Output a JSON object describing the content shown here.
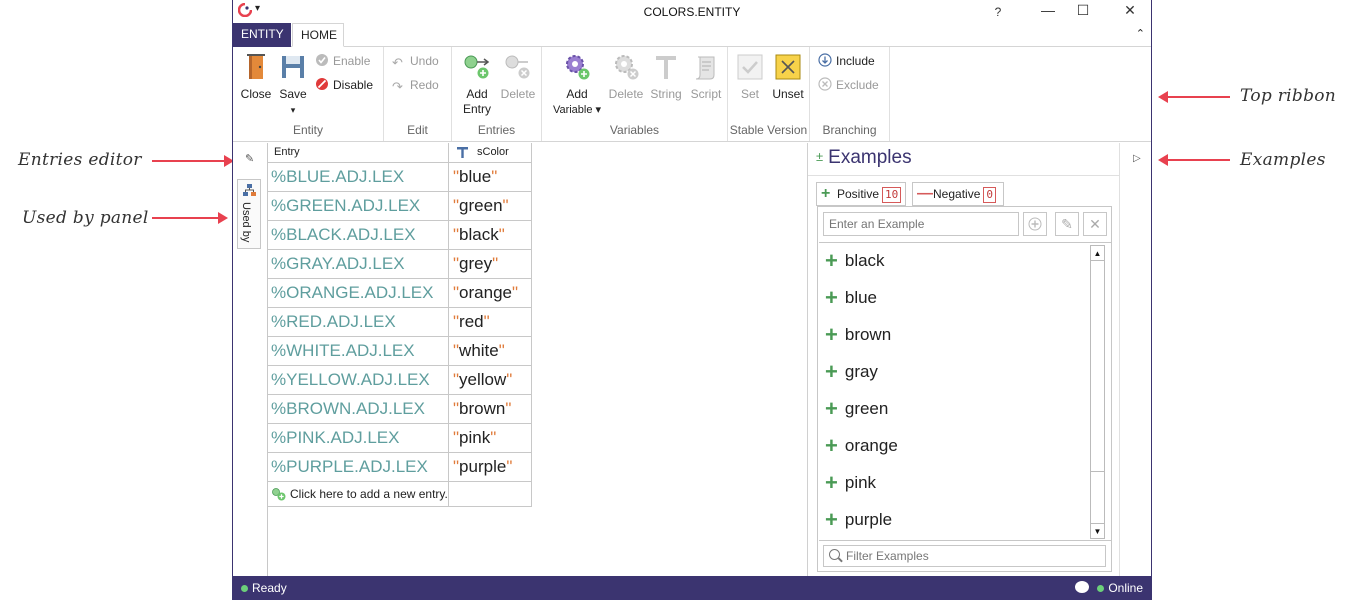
{
  "window": {
    "title": "COLORS.ENTITY",
    "help": "?",
    "min": "—",
    "max": "☐",
    "close": "✕",
    "quick_access": "▾"
  },
  "tabs": {
    "file": "ENTITY",
    "home": "HOME",
    "collapse": "⌃"
  },
  "ribbon": {
    "entity": {
      "label": "Entity",
      "close": "Close",
      "save": "Save",
      "save_arrow": "▾",
      "enable": "Enable",
      "disable": "Disable"
    },
    "edit": {
      "label": "Edit",
      "undo": "Undo",
      "redo": "Redo"
    },
    "entries": {
      "label": "Entries",
      "add_line1": "Add",
      "add_line2": "Entry",
      "delete": "Delete"
    },
    "variables": {
      "label": "Variables",
      "add_line1": "Add",
      "add_line2": "Variable ▾",
      "delete": "Delete",
      "string": "String",
      "script": "Script"
    },
    "stable": {
      "label": "Stable Version",
      "set": "Set",
      "unset": "Unset"
    },
    "branching": {
      "label": "Branching",
      "include": "Include",
      "exclude": "Exclude"
    }
  },
  "sidepanel": {
    "used_by": "Used by"
  },
  "grid": {
    "col_entry": "Entry",
    "col_var": "sColor",
    "rows": [
      {
        "entry": "%BLUE.ADJ.LEX",
        "value": "blue"
      },
      {
        "entry": "%GREEN.ADJ.LEX",
        "value": "green"
      },
      {
        "entry": "%BLACK.ADJ.LEX",
        "value": "black"
      },
      {
        "entry": "%GRAY.ADJ.LEX",
        "value": "grey"
      },
      {
        "entry": "%ORANGE.ADJ.LEX",
        "value": "orange"
      },
      {
        "entry": "%RED.ADJ.LEX",
        "value": "red"
      },
      {
        "entry": "%WHITE.ADJ.LEX",
        "value": "white"
      },
      {
        "entry": "%YELLOW.ADJ.LEX",
        "value": "yellow"
      },
      {
        "entry": "%BROWN.ADJ.LEX",
        "value": "brown"
      },
      {
        "entry": "%PINK.ADJ.LEX",
        "value": "pink"
      },
      {
        "entry": "%PURPLE.ADJ.LEX",
        "value": "purple"
      }
    ],
    "add_row": "Click here to add a new entry."
  },
  "examples": {
    "title": "Examples",
    "positive_label": "Positive",
    "positive_count": "10",
    "negative_label": "Negative",
    "negative_count": "0",
    "input_placeholder": "Enter an Example",
    "filter_placeholder": "Filter Examples",
    "items": [
      "black",
      "blue",
      "brown",
      "gray",
      "green",
      "orange",
      "pink",
      "purple"
    ]
  },
  "status": {
    "left": "Ready",
    "right": "Online"
  },
  "annotations": {
    "entries_editor": "Entries editor",
    "used_by_panel": "Used by panel",
    "top_ribbon": "Top ribbon",
    "examples": "Examples"
  },
  "colors": {
    "accent": "#3b3470",
    "entry_text": "#5f9e9e",
    "arrow": "#e8414f",
    "positive": "#4a9a55"
  }
}
